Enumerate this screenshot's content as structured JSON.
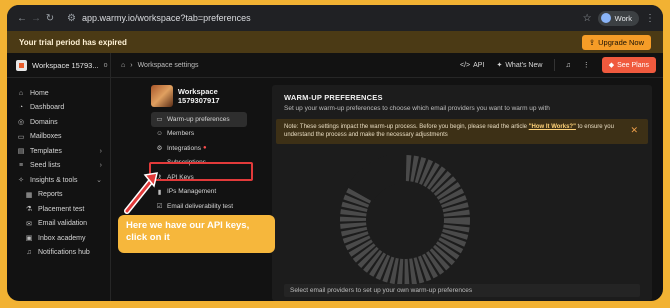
{
  "browser": {
    "url": "app.warmy.io/workspace?tab=preferences",
    "profile": "Work"
  },
  "trial": {
    "message": "Your trial period has expired",
    "upgrade": "Upgrade Now"
  },
  "header": {
    "workspace_name": "Workspace 15793...",
    "breadcrumb": "Workspace settings",
    "api": "API",
    "whats_new": "What's New",
    "see_plans": "See Plans"
  },
  "sidebar": {
    "items": [
      {
        "label": "Home",
        "icon": "home-icon"
      },
      {
        "label": "Dashboard",
        "icon": "dashboard-icon"
      },
      {
        "label": "Domains",
        "icon": "globe-icon"
      },
      {
        "label": "Mailboxes",
        "icon": "mailbox-icon"
      },
      {
        "label": "Templates",
        "icon": "template-icon"
      },
      {
        "label": "Seed lists",
        "icon": "list-icon"
      },
      {
        "label": "Insights & tools",
        "icon": "insights-icon"
      },
      {
        "label": "Reports",
        "icon": "report-icon"
      },
      {
        "label": "Placement test",
        "icon": "test-icon"
      },
      {
        "label": "Email validation",
        "icon": "validation-icon"
      },
      {
        "label": "Inbox academy",
        "icon": "academy-icon"
      },
      {
        "label": "Notifications hub",
        "icon": "bell-icon"
      }
    ]
  },
  "workspace_nav": {
    "title": "Workspace 1579307917",
    "items": [
      {
        "label": "Warm-up preferences",
        "icon": "preferences-icon"
      },
      {
        "label": "Members",
        "icon": "members-icon"
      },
      {
        "label": "Integrations",
        "icon": "integrations-icon"
      },
      {
        "label": "Subscriptions",
        "icon": "subscription-icon"
      },
      {
        "label": "API Keys",
        "icon": "key-icon"
      },
      {
        "label": "IPs Management",
        "icon": "ip-icon"
      },
      {
        "label": "Email deliverability test",
        "icon": "checkbox-icon"
      }
    ]
  },
  "panel": {
    "title": "WARM-UP PREFERENCES",
    "subtitle": "Set up your warm-up preferences to choose which email providers you want to warm up with",
    "note_prefix": "Note: These settings impact the warm-up process. Before you begin, please read the article ",
    "note_link": "\"How It Works?\"",
    "note_suffix": " to ensure you understand the process and make the necessary adjustments",
    "footer": "Select email providers to set up your own warm-up preferences"
  },
  "callout": {
    "text": "Here we have our API keys, click on it"
  },
  "colors": {
    "frame_border": "#f2b233",
    "accent_orange": "#f59c27",
    "see_plans": "#f05a3e",
    "highlight_red": "#e23a3a"
  }
}
